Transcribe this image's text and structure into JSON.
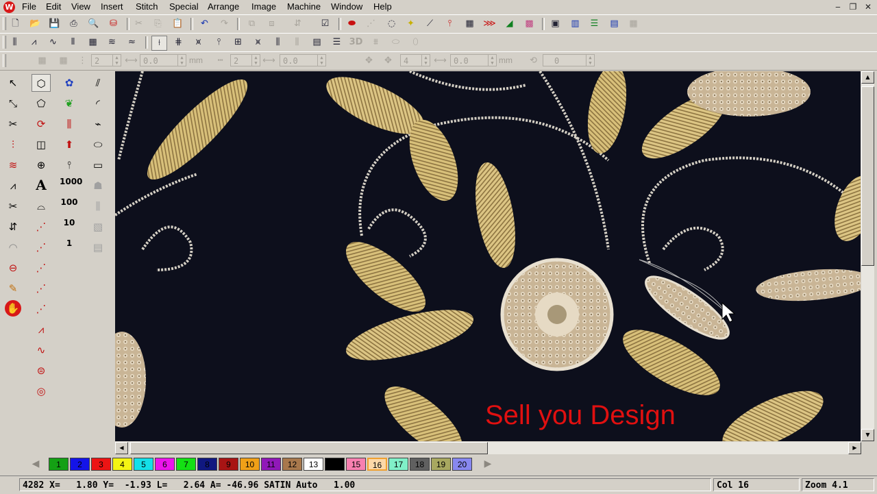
{
  "menu": {
    "items": [
      "File",
      "Edit",
      "View",
      "Insert",
      "Stitch",
      "Special",
      "Arrange",
      "Image",
      "Machine",
      "Window",
      "Help"
    ]
  },
  "app": {
    "logo_text": "W"
  },
  "toolbar1": {
    "icons": [
      "new-file-icon",
      "open-folder-icon",
      "save-icon",
      "print-icon",
      "print-preview-icon",
      "export-icon",
      "cut-icon",
      "copy-icon",
      "paste-icon",
      "undo-icon",
      "redo-icon",
      "group-icon",
      "ungroup-icon",
      "align-icon",
      "check-box-icon",
      "red-stitch-icon",
      "trace-icon",
      "outline-icon",
      "color-wand-icon",
      "needle-icon",
      "tack-icon",
      "grid-icon",
      "red-tool-icon",
      "green-tool-icon",
      "color-map-icon",
      "monitor-icon",
      "columns-icon",
      "list-icon",
      "bars-icon"
    ]
  },
  "toolbar2": {
    "three_d_label": "3D",
    "icons": [
      "satin-stitch-icon",
      "zigzag-icon",
      "wave-stitch-icon",
      "fill-stitch-icon",
      "pattern-fill-icon",
      "wave-fill-icon",
      "zigzag-dense-icon",
      "stitch-angle-icon",
      "stitch-grid-icon",
      "triangle-stitch-icon",
      "comb-stitch-icon",
      "fill-column-icon",
      "tatami-icon",
      "parallel-lines-icon",
      "3d-icon",
      "underlay-icon",
      "oval-icon",
      "oval-fill-icon"
    ]
  },
  "toolbar3": {
    "field1": "2",
    "field2": "0.0",
    "unit1": "mm",
    "field3": "2",
    "field4": "0.0",
    "unit2": "mm",
    "field5": "4",
    "field6": "0.0",
    "unit3": "mm",
    "field7": "0"
  },
  "toolbox": {
    "labels": {
      "text_tool": "A",
      "count_1000": "1000",
      "count_100": "100",
      "count_10": "10",
      "count_1": "1"
    }
  },
  "canvas": {
    "watermark": "Sell you Design",
    "background": "#0d0f1c",
    "thread_gold": "#d8c07a",
    "thread_silver": "#d4cfc4"
  },
  "palette": {
    "swatches": [
      {
        "label": "1",
        "color": "#14a014",
        "text": "#000000"
      },
      {
        "label": "2",
        "color": "#1414e8",
        "text": "#000000"
      },
      {
        "label": "3",
        "color": "#ec1414",
        "text": "#000000"
      },
      {
        "label": "4",
        "color": "#f4f414",
        "text": "#000000"
      },
      {
        "label": "5",
        "color": "#14e0e8",
        "text": "#000000"
      },
      {
        "label": "6",
        "color": "#ec14ec",
        "text": "#000000"
      },
      {
        "label": "7",
        "color": "#14e014",
        "text": "#000000"
      },
      {
        "label": "8",
        "color": "#101880",
        "text": "#000000"
      },
      {
        "label": "9",
        "color": "#a81414",
        "text": "#000000"
      },
      {
        "label": "10",
        "color": "#f0a018",
        "text": "#000000"
      },
      {
        "label": "11",
        "color": "#9018b8",
        "text": "#000000"
      },
      {
        "label": "12",
        "color": "#a8784c",
        "text": "#000000"
      },
      {
        "label": "13",
        "color": "#ffffff",
        "text": "#000000"
      },
      {
        "label": "14",
        "color": "#000000",
        "text": "#000000"
      },
      {
        "label": "15",
        "color": "#f880b0",
        "text": "#000000"
      },
      {
        "label": "16",
        "color": "#fcd8a8",
        "text": "#000000"
      },
      {
        "label": "17",
        "color": "#80f0c8",
        "text": "#000000"
      },
      {
        "label": "18",
        "color": "#606060",
        "text": "#000000"
      },
      {
        "label": "19",
        "color": "#a8a860",
        "text": "#000000"
      },
      {
        "label": "20",
        "color": "#8888f0",
        "text": "#000000"
      }
    ],
    "active": "16"
  },
  "status": {
    "left": "4282 X=   1.80 Y=  -1.93 L=   2.64 A= -46.96 SATIN Auto   1.00",
    "col": "Col 16",
    "zoom": "Zoom 4.1"
  }
}
